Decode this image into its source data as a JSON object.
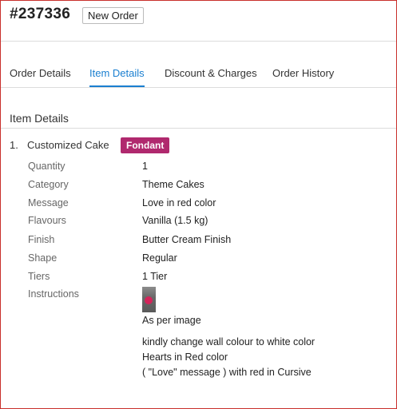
{
  "order": {
    "id": "#237336",
    "status": "New Order"
  },
  "tabs": [
    {
      "label": "Order Details",
      "active": false
    },
    {
      "label": "Item Details",
      "active": true
    },
    {
      "label": "Discount & Charges",
      "active": false
    },
    {
      "label": "Order History",
      "active": false
    }
  ],
  "section_title": "Item Details",
  "item": {
    "index": "1.",
    "name": "Customized Cake",
    "badge": "Fondant",
    "fields": [
      {
        "label": "Quantity",
        "value": "1"
      },
      {
        "label": "Category",
        "value": "Theme Cakes"
      },
      {
        "label": "Message",
        "value": "Love in red color"
      },
      {
        "label": "Flavours",
        "value": "Vanilla (1.5 kg)"
      },
      {
        "label": "Finish",
        "value": "Butter Cream Finish"
      },
      {
        "label": "Shape",
        "value": "Regular"
      },
      {
        "label": "Tiers",
        "value": "1 Tier"
      }
    ],
    "instructions": {
      "label": "Instructions",
      "image_caption": "As per image",
      "lines": [
        "kindly change wall colour to white color",
        "Hearts in Red color",
        "( \"Love\" message ) with red in Cursive"
      ]
    }
  },
  "colors": {
    "accent": "#1a7fd0",
    "badge": "#b0296e",
    "frame": "#c9302c"
  }
}
